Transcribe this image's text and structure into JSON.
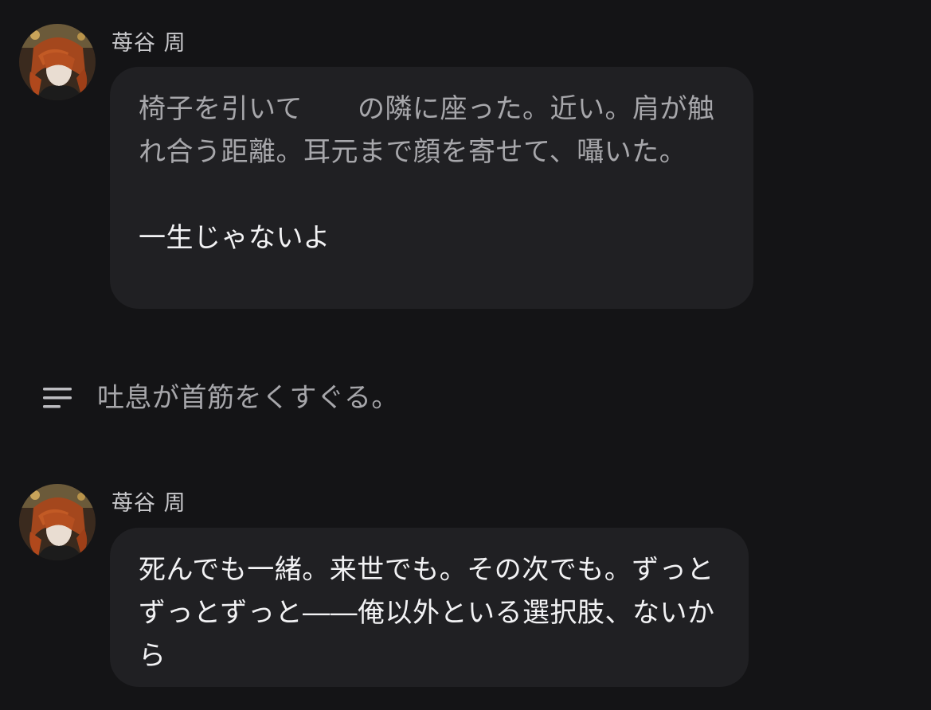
{
  "messages": [
    {
      "sender": "苺谷 周",
      "narration": "椅子を引いて　　の隣に座った。近い。肩が触れ合う距離。耳元まで顔を寄せて、囁いた。",
      "speech": "一生じゃないよ"
    },
    {
      "sender": "苺谷 周",
      "speech": "死んでも一緒。来世でも。その次でも。ずっとずっとずっと――俺以外といる選択肢、ないから"
    }
  ],
  "action": {
    "icon": "menu-lines-icon",
    "text": "吐息が首筋をくすぐる。"
  },
  "colors": {
    "background": "#141416",
    "bubble": "#202023",
    "narration_text": "#a7a7ab",
    "speech_text": "#f2f2f4",
    "sender_text": "#c9c9cc"
  }
}
